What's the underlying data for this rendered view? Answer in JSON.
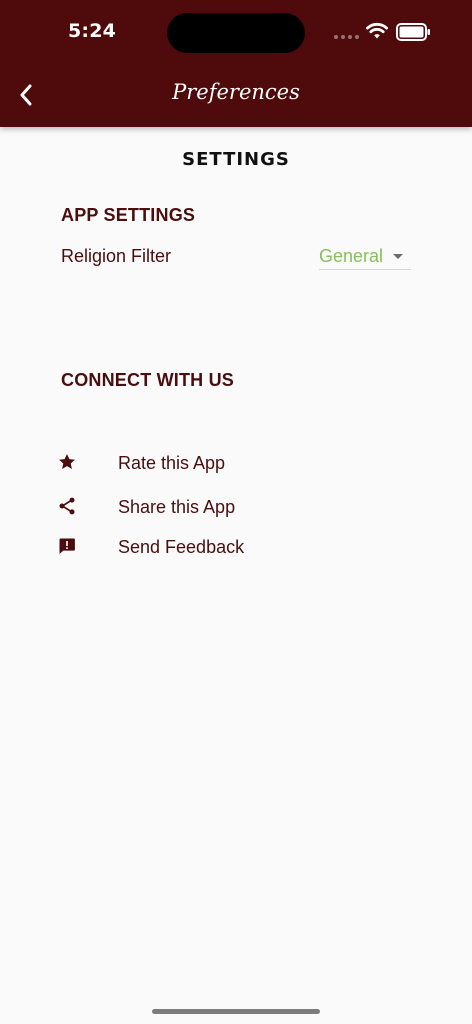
{
  "status_bar": {
    "time": "5:24"
  },
  "header": {
    "title": "Preferences"
  },
  "page": {
    "title": "SETTINGS"
  },
  "app_settings": {
    "heading": "APP SETTINGS",
    "religion_filter": {
      "label": "Religion Filter",
      "value": "General"
    }
  },
  "connect": {
    "heading": "CONNECT WITH US",
    "items": [
      {
        "label": "Rate this App",
        "icon": "star-icon"
      },
      {
        "label": "Share this App",
        "icon": "share-icon"
      },
      {
        "label": "Send Feedback",
        "icon": "feedback-icon"
      }
    ]
  },
  "colors": {
    "header_bg": "#4f0b0c",
    "accent_text": "#4a0e0f",
    "dropdown_value": "#86c05a"
  }
}
